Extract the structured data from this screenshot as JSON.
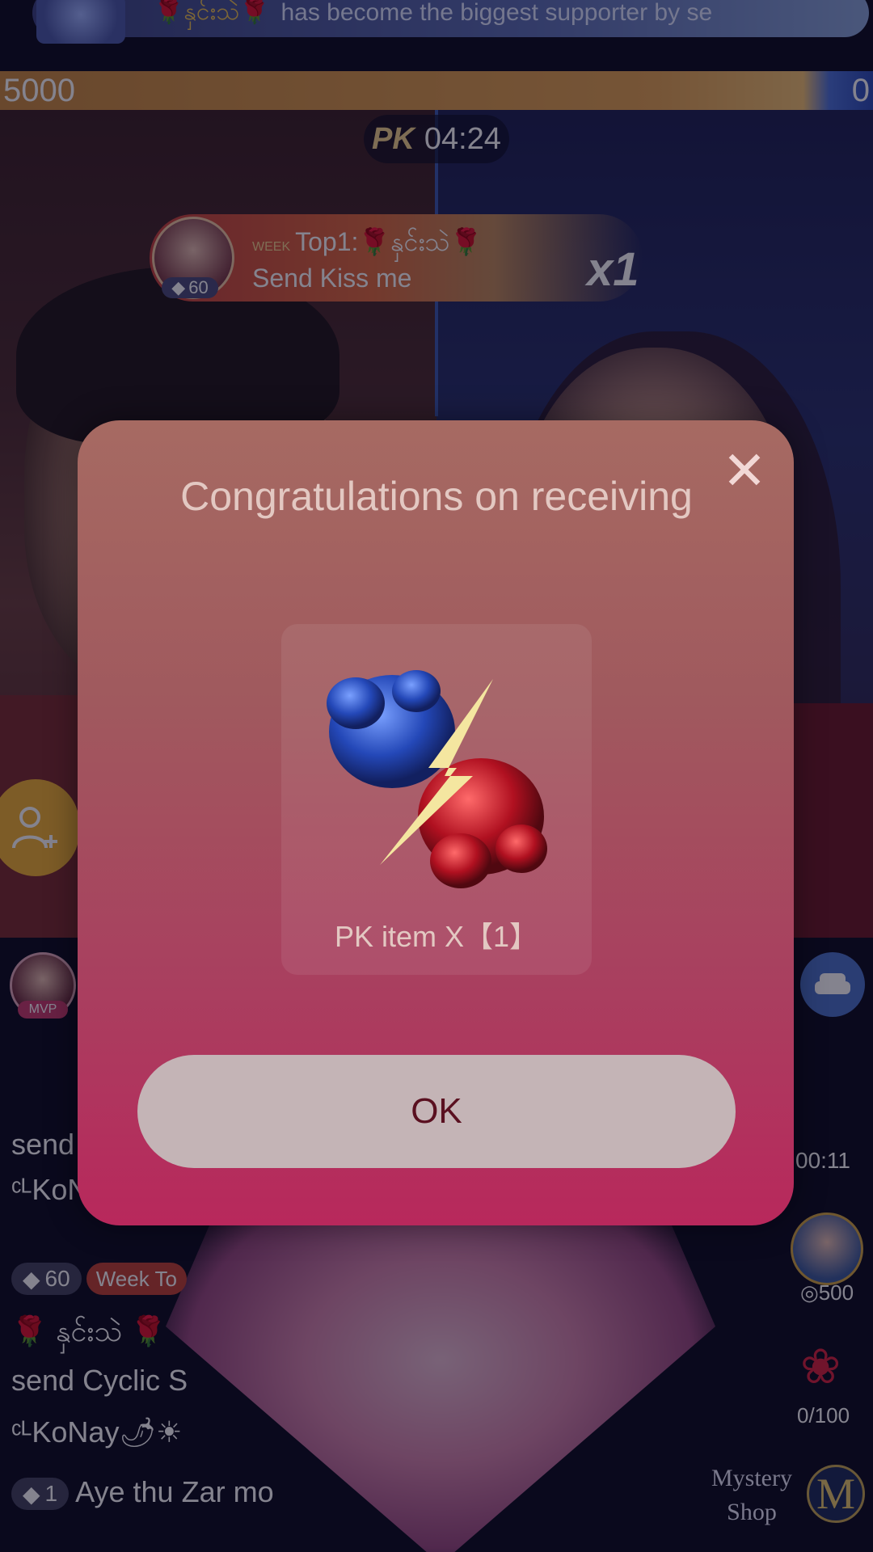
{
  "banner": {
    "name": "🌹နှင်းသဲ🌹",
    "text": "has become the biggest supporter by se"
  },
  "pk": {
    "score_left": "5000",
    "score_right": "0",
    "logo": "PK",
    "time": "04:24"
  },
  "top_gift": {
    "week_label": "WEEK",
    "title": "Top1:🌹နှင်းသဲ🌹",
    "message": "Send Kiss me",
    "level": "60",
    "multiplier": "x1"
  },
  "side": {
    "mvp_label": "MVP",
    "pk_countdown": "00:11",
    "supporter_value": "500",
    "rose_progress": "0/100",
    "mystery_line1": "Mystery",
    "mystery_line2": "Shop",
    "mystery_badge": "M"
  },
  "chat": {
    "row1": "send",
    "row2": "ᶜᴸKoNay",
    "row3_level": "60",
    "row3_week": "Week To",
    "row4": "🌹 နှင်းသဲ 🌹",
    "row5": "send Cyclic S",
    "row6": "ᶜᴸKoNay🌶☀",
    "row7_level": "1",
    "row7_text": "Aye thu Zar mo"
  },
  "modal": {
    "title": "Congratulations on receiving",
    "gift_caption": "PK item X【1】",
    "ok_label": "OK",
    "close_icon": "close-icon"
  },
  "colors": {
    "modal_top": "#a66a62",
    "modal_bottom": "#b8285c",
    "ok_button": "#c4b4b6",
    "ok_text": "#5a1020",
    "score_left_bar": "#e2a250",
    "score_right_bar": "#2a4bb4"
  }
}
